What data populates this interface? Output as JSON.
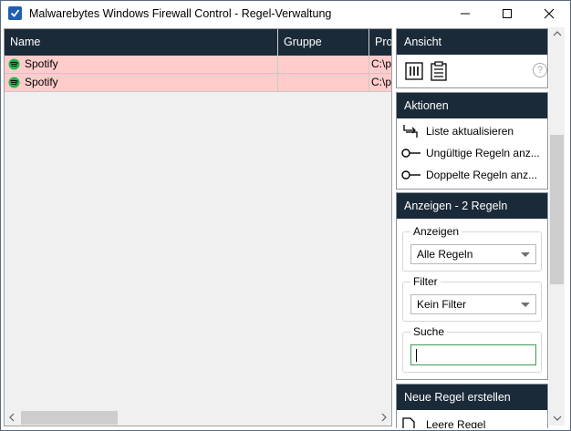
{
  "window": {
    "title": "Malwarebytes Windows Firewall Control - Regel-Verwaltung"
  },
  "table": {
    "columns": [
      "Name",
      "Gruppe",
      "Pro"
    ],
    "rows": [
      {
        "name": "Spotify",
        "gruppe": "",
        "pro": "C:\\p",
        "icon": "spotify-icon"
      },
      {
        "name": "Spotify",
        "gruppe": "",
        "pro": "C:\\p",
        "icon": "spotify-icon"
      }
    ]
  },
  "panel": {
    "ansicht": {
      "title": "Ansicht",
      "help": "?"
    },
    "aktionen": {
      "title": "Aktionen",
      "items": [
        "Liste aktualisieren",
        "Ungültige Regeln anz...",
        "Doppelte Regeln anz..."
      ]
    },
    "anzeigen": {
      "title": "Anzeigen - 2 Regeln",
      "anzeigen_label": "Anzeigen",
      "anzeigen_value": "Alle Regeln",
      "filter_label": "Filter",
      "filter_value": "Kein Filter",
      "suche_label": "Suche",
      "suche_value": ""
    },
    "neue_regel": {
      "title": "Neue Regel erstellen",
      "item": "Leere Regel"
    }
  },
  "colors": {
    "header_bg": "#1b2a38",
    "row_highlight": "#ffcccc",
    "spotify_green": "#1db954",
    "search_border": "#3c9c54"
  }
}
